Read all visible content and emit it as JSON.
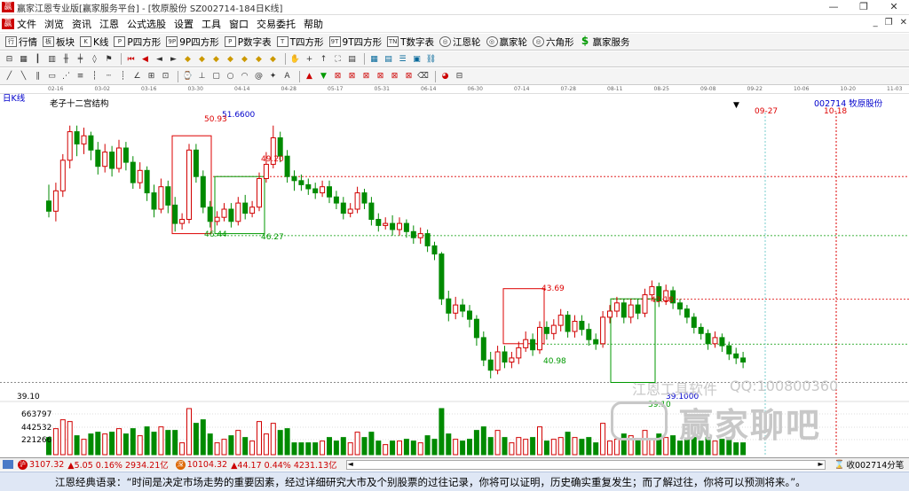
{
  "window": {
    "title": "赢家江恩专业版[赢家服务平台] - [牧原股份  SZ002714-184日K线]",
    "logo": "赢"
  },
  "menu": {
    "items": [
      "文件",
      "浏览",
      "资讯",
      "江恩",
      "公式选股",
      "设置",
      "工具",
      "窗口",
      "交易委托",
      "帮助"
    ]
  },
  "toolbar1": {
    "items": [
      {
        "icon": "行",
        "label": "行情"
      },
      {
        "icon": "板",
        "label": "板块"
      },
      {
        "icon": "K",
        "label": "K线"
      },
      {
        "icon": "P",
        "label": "P四方形"
      },
      {
        "icon": "9P",
        "label": "9P四方形"
      },
      {
        "icon": "P",
        "label": "P数字表"
      },
      {
        "icon": "T",
        "label": "T四方形"
      },
      {
        "icon": "9T",
        "label": "9T四方形"
      },
      {
        "icon": "TN",
        "label": "T数字表"
      },
      {
        "icon": "◎",
        "label": "江恩轮"
      },
      {
        "icon": "◎",
        "label": "赢家轮"
      },
      {
        "icon": "◎",
        "label": "六角形"
      },
      {
        "icon": "$",
        "label": "赢家服务"
      }
    ]
  },
  "chart": {
    "period_tag": "日K线",
    "pattern_name": "老子十二宫结构",
    "stock_label": "002714 牧原股份",
    "date_axis": [
      "02-16",
      "03-02",
      "03-16",
      "03-30",
      "04-14",
      "04-28",
      "05-17",
      "05-31",
      "06-14",
      "06-30",
      "07-14",
      "07-28",
      "08-11",
      "08-25",
      "09-08",
      "09-22",
      "10-06",
      "10-20",
      "11-03"
    ],
    "future_dates": [
      "09-27",
      "10-18"
    ],
    "levels": {
      "high": "51.6600",
      "low": "39.1000",
      "axis_low": "39.10"
    },
    "price_labels": [
      "50.93",
      "49.20",
      "46.44",
      "46.27",
      "43.69",
      "43.18",
      "40.98",
      "39.10"
    ],
    "volume_ticks": [
      "663797",
      "442532",
      "221266"
    ],
    "colors": {
      "up": "#d10000",
      "down": "#008a00",
      "bg": "#ffffff"
    }
  },
  "chart_data": {
    "type": "candlestick",
    "title": "老子十二宫结构",
    "series": [
      {
        "name": "002714 牧原股份",
        "values": [
          [
            48.0,
            47.5,
            48.8,
            47.2
          ],
          [
            47.5,
            48.5,
            48.9,
            47.0
          ],
          [
            48.5,
            50.0,
            50.3,
            48.2
          ],
          [
            50.0,
            51.4,
            51.7,
            49.6
          ],
          [
            51.4,
            50.8,
            51.7,
            50.2
          ],
          [
            50.8,
            51.2,
            51.6,
            50.3
          ],
          [
            51.2,
            50.5,
            51.4,
            50.0
          ],
          [
            50.5,
            49.7,
            50.9,
            49.3
          ],
          [
            49.7,
            50.4,
            50.8,
            49.4
          ],
          [
            50.4,
            49.6,
            50.7,
            49.2
          ],
          [
            49.6,
            50.6,
            51.0,
            49.4
          ],
          [
            50.6,
            49.9,
            50.9,
            49.5
          ],
          [
            49.9,
            48.9,
            50.2,
            48.6
          ],
          [
            48.9,
            49.5,
            49.9,
            48.6
          ],
          [
            49.5,
            48.4,
            49.7,
            48.0
          ],
          [
            48.4,
            47.6,
            48.8,
            47.2
          ],
          [
            47.6,
            48.7,
            49.1,
            47.4
          ],
          [
            48.7,
            47.8,
            49.0,
            47.4
          ],
          [
            47.8,
            46.9,
            48.2,
            46.5
          ],
          [
            46.9,
            47.1,
            47.4,
            46.6
          ],
          [
            47.1,
            50.5,
            50.8,
            46.9
          ],
          [
            50.5,
            49.2,
            50.8,
            48.9
          ],
          [
            49.2,
            47.7,
            49.5,
            47.4
          ],
          [
            47.7,
            47.0,
            48.0,
            46.7
          ],
          [
            47.0,
            47.2,
            47.5,
            46.8
          ],
          [
            47.2,
            47.6,
            47.9,
            47.0
          ],
          [
            47.6,
            47.0,
            47.9,
            46.7
          ],
          [
            47.0,
            47.9,
            48.2,
            46.8
          ],
          [
            47.9,
            47.4,
            48.3,
            47.1
          ],
          [
            47.4,
            47.7,
            48.0,
            47.2
          ],
          [
            47.7,
            49.1,
            49.4,
            47.5
          ],
          [
            49.1,
            49.8,
            50.4,
            48.9
          ],
          [
            49.8,
            51.1,
            51.7,
            49.6
          ],
          [
            51.1,
            50.2,
            51.4,
            49.9
          ],
          [
            50.2,
            49.2,
            50.5,
            48.9
          ],
          [
            49.2,
            49.0,
            49.5,
            48.5
          ],
          [
            49.0,
            48.8,
            49.3,
            48.5
          ],
          [
            48.8,
            48.6,
            49.1,
            48.3
          ],
          [
            48.6,
            48.4,
            48.9,
            48.1
          ],
          [
            48.4,
            48.7,
            49.0,
            48.2
          ],
          [
            48.7,
            48.2,
            49.0,
            47.9
          ],
          [
            48.2,
            47.9,
            48.5,
            47.6
          ],
          [
            47.9,
            47.4,
            48.2,
            47.1
          ],
          [
            47.4,
            47.6,
            47.9,
            47.2
          ],
          [
            47.6,
            48.4,
            48.7,
            47.4
          ],
          [
            48.4,
            47.9,
            48.6,
            47.6
          ],
          [
            47.9,
            47.1,
            48.2,
            46.8
          ],
          [
            47.1,
            46.8,
            47.4,
            46.5
          ],
          [
            46.8,
            46.9,
            47.2,
            46.6
          ],
          [
            46.9,
            46.6,
            47.3,
            46.3
          ],
          [
            46.6,
            46.9,
            47.2,
            46.3
          ],
          [
            46.9,
            46.5,
            47.1,
            46.2
          ],
          [
            46.5,
            46.2,
            46.8,
            45.9
          ],
          [
            46.2,
            46.4,
            46.7,
            45.9
          ],
          [
            46.4,
            45.8,
            46.6,
            45.5
          ],
          [
            45.8,
            45.4,
            46.0,
            45.1
          ],
          [
            45.4,
            43.2,
            45.5,
            42.9
          ],
          [
            43.2,
            42.5,
            43.6,
            42.1
          ],
          [
            42.5,
            42.9,
            43.3,
            42.2
          ],
          [
            42.9,
            42.6,
            43.2,
            42.3
          ],
          [
            42.6,
            42.2,
            42.9,
            41.8
          ],
          [
            42.2,
            41.3,
            42.4,
            40.9
          ],
          [
            41.3,
            40.2,
            41.6,
            39.9
          ],
          [
            40.2,
            39.7,
            40.6,
            39.3
          ],
          [
            39.7,
            40.6,
            40.9,
            39.5
          ],
          [
            40.6,
            40.1,
            40.9,
            39.8
          ],
          [
            40.1,
            40.3,
            40.6,
            39.8
          ],
          [
            40.3,
            40.8,
            41.1,
            40.0
          ],
          [
            40.8,
            41.2,
            41.6,
            40.6
          ],
          [
            41.2,
            40.7,
            41.5,
            40.4
          ],
          [
            40.7,
            41.8,
            42.1,
            40.5
          ],
          [
            41.8,
            41.5,
            42.1,
            41.2
          ],
          [
            41.5,
            41.9,
            42.2,
            41.2
          ],
          [
            41.9,
            42.4,
            42.7,
            41.6
          ],
          [
            42.4,
            41.6,
            42.6,
            41.3
          ],
          [
            41.6,
            42.1,
            42.4,
            41.3
          ],
          [
            42.1,
            41.7,
            42.4,
            41.4
          ],
          [
            41.7,
            41.2,
            42.0,
            40.9
          ],
          [
            41.2,
            41.0,
            41.5,
            40.7
          ],
          [
            41.0,
            42.3,
            42.6,
            40.8
          ],
          [
            42.3,
            42.6,
            42.9,
            42.0
          ],
          [
            42.6,
            43.0,
            43.3,
            42.3
          ],
          [
            43.0,
            42.3,
            43.2,
            42.0
          ],
          [
            42.3,
            42.9,
            43.2,
            42.0
          ],
          [
            42.9,
            42.5,
            43.2,
            42.2
          ],
          [
            42.5,
            43.4,
            43.7,
            42.3
          ],
          [
            43.4,
            43.8,
            44.1,
            43.2
          ],
          [
            43.8,
            43.1,
            44.0,
            42.8
          ],
          [
            43.1,
            43.6,
            43.9,
            42.9
          ],
          [
            43.6,
            43.0,
            43.8,
            42.7
          ],
          [
            43.0,
            42.7,
            43.2,
            42.4
          ],
          [
            42.7,
            42.3,
            42.9,
            42.0
          ],
          [
            42.3,
            41.8,
            42.5,
            41.5
          ],
          [
            41.8,
            41.5,
            42.0,
            41.2
          ],
          [
            41.5,
            41.0,
            41.7,
            40.7
          ],
          [
            41.0,
            41.3,
            41.6,
            40.8
          ],
          [
            41.3,
            40.9,
            41.5,
            40.6
          ],
          [
            40.9,
            40.5,
            41.1,
            40.2
          ],
          [
            40.5,
            40.3,
            40.8,
            40.0
          ],
          [
            40.3,
            40.1,
            40.6,
            39.8
          ]
        ]
      }
    ],
    "volume_ticks": [
      663797,
      442532,
      221266
    ],
    "annotations": [
      "50.93",
      "49.20",
      "46.44",
      "46.27",
      "43.69",
      "43.18",
      "40.98",
      "39.10",
      "51.6600",
      "39.1000"
    ]
  },
  "status": {
    "sh_index": "3107.32",
    "sh_change": "▲5.05 0.16% 2934.21亿",
    "sz_index": "10104.32",
    "sz_change": "▲44.17 0.44% 4231.13亿",
    "right_text": "收002714分笔"
  },
  "footer": {
    "quote": "江恩经典语录：“时间是决定市场走势的重要因素，经过详细研究大市及个别股票的过往记录，你将可以证明，历史确实重复发生；而了解过往，你将可以预测将来。”。"
  },
  "watermark": {
    "text1": "江恩工具软件",
    "text2": "QQ:100800360",
    "text3": "赢家聊吧"
  }
}
